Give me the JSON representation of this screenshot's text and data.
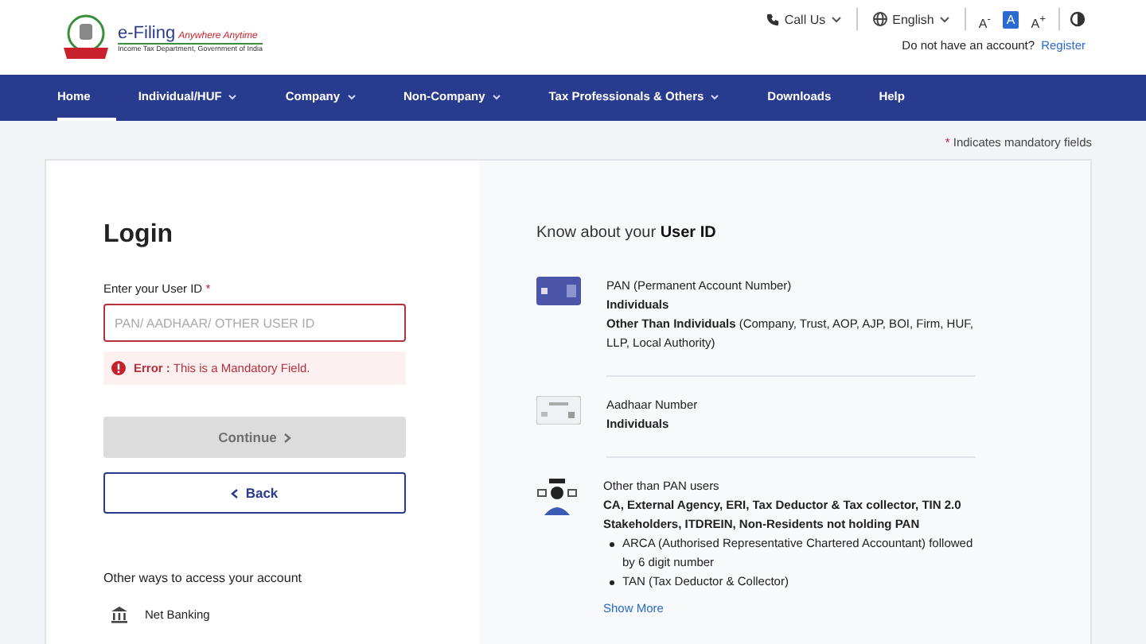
{
  "header": {
    "logo_title": "e-Filing",
    "logo_tagline": "Anywhere Anytime",
    "logo_subtitle": "Income Tax Department, Government of India",
    "call_us": "Call Us",
    "language": "English",
    "font_buttons": [
      {
        "label": "A$^{-}$",
        "selected": false
      },
      {
        "label": "A",
        "selected": true
      },
      {
        "label": "A$^{+}$",
        "selected": false
      }
    ],
    "account_prompt": "Do not have an account?",
    "register_link": "Register"
  },
  "nav": [
    {
      "label": "Home",
      "selected": true,
      "has_menu": false
    },
    {
      "label": "Individual/HUF",
      "selected": false,
      "has_menu": true
    },
    {
      "label": "Company",
      "selected": false,
      "has_menu": true
    },
    {
      "label": "Non-Company",
      "selected": false,
      "has_menu": true
    },
    {
      "label": "Tax Professionals & Others",
      "selected": false,
      "has_menu": true
    },
    {
      "label": "Downloads",
      "selected": false,
      "has_menu": false
    },
    {
      "label": "Help",
      "selected": false,
      "has_menu": false
    }
  ],
  "mandatory_note": {
    "mark": "*",
    "text": "Indicates mandatory fields"
  },
  "login": {
    "title": "Login",
    "field_label": "Enter your User ID",
    "required_mark": "*",
    "placeholder": "PAN/ AADHAAR/ OTHER USER ID",
    "error": "**Error :** This is a Mandatory Field.",
    "continue": "Continue",
    "continue_disabled": true,
    "back": "Back",
    "other_ways": "Other ways to access your account",
    "net_banking": "Net Banking"
  },
  "know": {
    "title_prefix": "Know about your",
    "title_bold": "User ID",
    "items": [
      {
        "kind": "card",
        "lines": [
          "PAN (Permanent Account Number)",
          "**Individuals**",
          "**Other Than Individuals** (Company, Trust, AOP, AJP, BOI, Firm, HUF, LLP, Local Authority)"
        ]
      },
      {
        "kind": "aadhaar",
        "lines": [
          "Aadhaar Number",
          "**Individuals**"
        ]
      },
      {
        "kind": "users",
        "lines": [
          "Other than PAN users",
          "**CA, External Agency, ERI, Tax Deductor & Tax collector, TIN 2.0 Stakeholders, ITDREIN, Non-Residents not holding PAN**"
        ],
        "bullets": [
          "ARCA (Authorised Representative Chartered Accountant) followed by 6 digit number",
          "TAN (Tax Deductor & Collector)"
        ]
      }
    ],
    "show_more": "Show More"
  }
}
